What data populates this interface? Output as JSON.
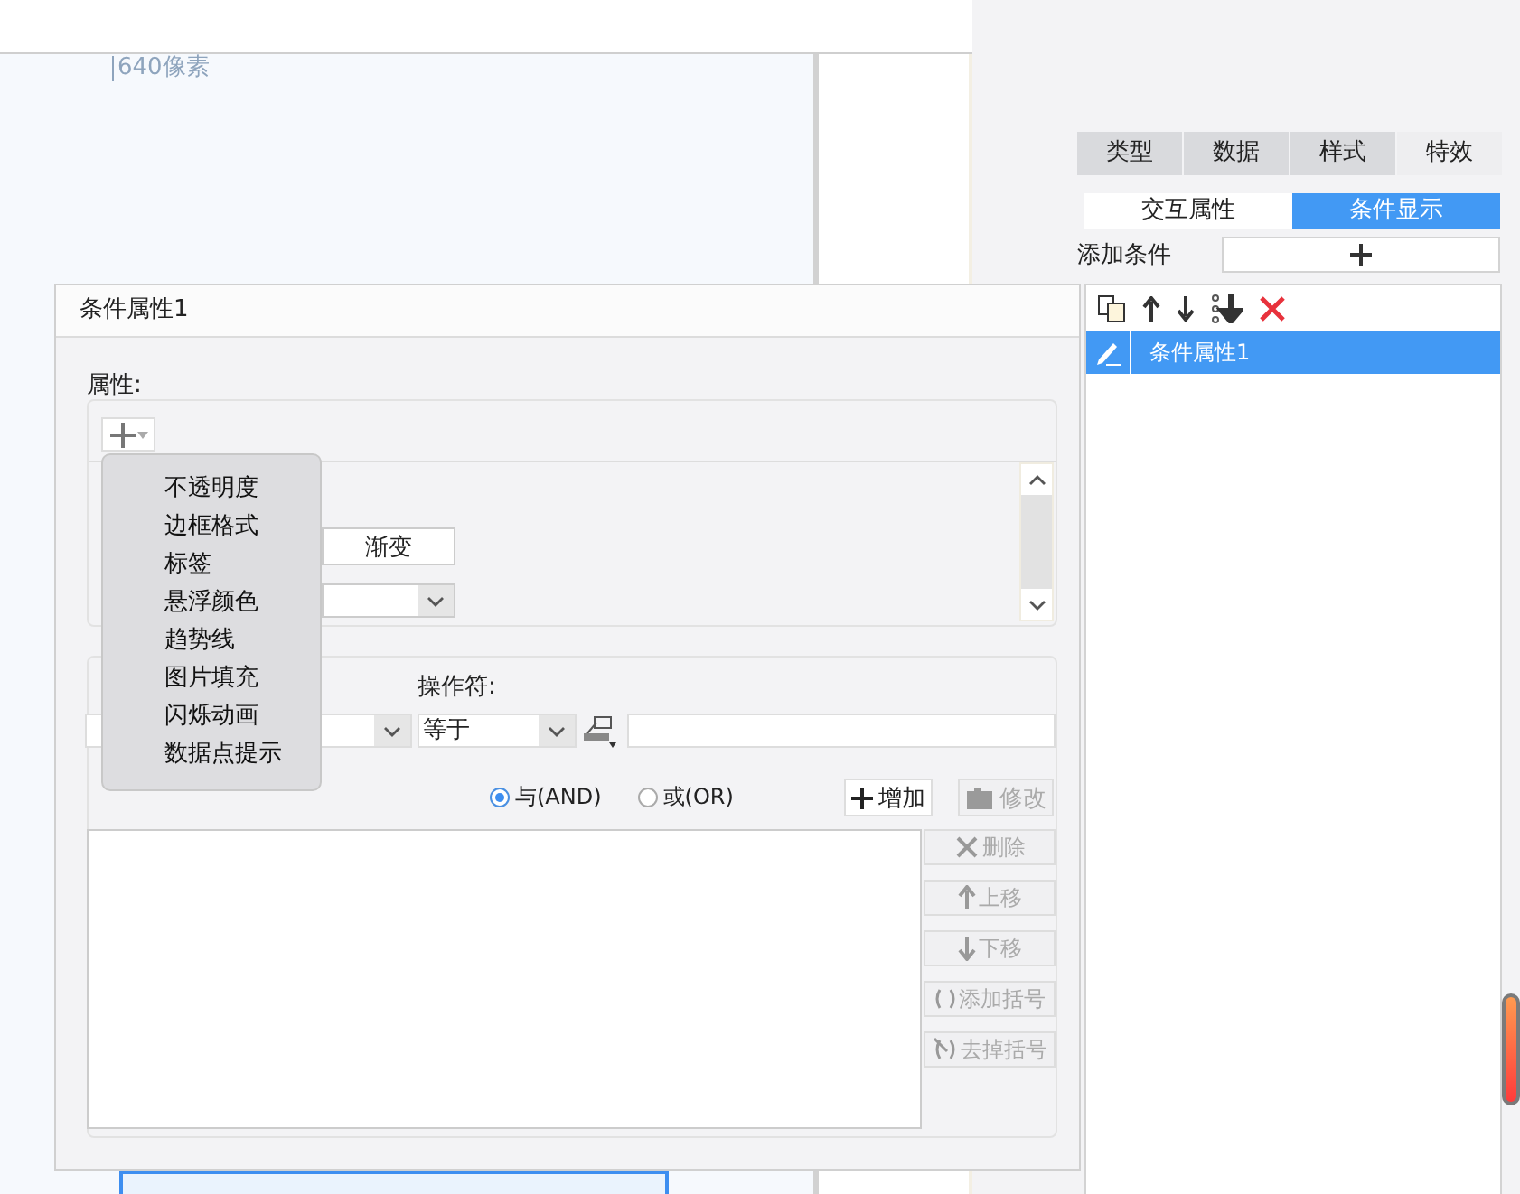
{
  "canvas": {
    "size_label": "640像素"
  },
  "panel": {
    "tabs": [
      {
        "label": "类型",
        "selected": false
      },
      {
        "label": "数据",
        "selected": false
      },
      {
        "label": "样式",
        "selected": false
      },
      {
        "label": "特效",
        "selected": true
      }
    ],
    "subtabs": [
      {
        "label": "交互属性",
        "selected": false
      },
      {
        "label": "条件显示",
        "selected": true
      }
    ],
    "add_condition_label": "添加条件",
    "conditions": [
      {
        "label": "条件属性1",
        "selected": true
      }
    ]
  },
  "dialog": {
    "title": "条件属性1",
    "properties_label": "属性:",
    "gradient_cell": "渐变",
    "operator_label": "操作符:",
    "operator_value": "等于",
    "logic": [
      {
        "label": "与(AND)",
        "selected": true
      },
      {
        "label": "或(OR)",
        "selected": false
      }
    ],
    "buttons": [
      {
        "label": "增加",
        "disabled": false
      },
      {
        "label": "修改",
        "disabled": true
      }
    ],
    "side_buttons": [
      {
        "label": "删除",
        "disabled": true
      },
      {
        "label": "上移",
        "disabled": true
      },
      {
        "label": "下移",
        "disabled": true
      },
      {
        "label": "添加括号",
        "disabled": true
      },
      {
        "label": "去掉括号",
        "disabled": true
      }
    ]
  },
  "menu": {
    "items": [
      "不透明度",
      "边框格式",
      "标签",
      "悬浮颜色",
      "趋势线",
      "图片填充",
      "闪烁动画",
      "数据点提示"
    ]
  }
}
